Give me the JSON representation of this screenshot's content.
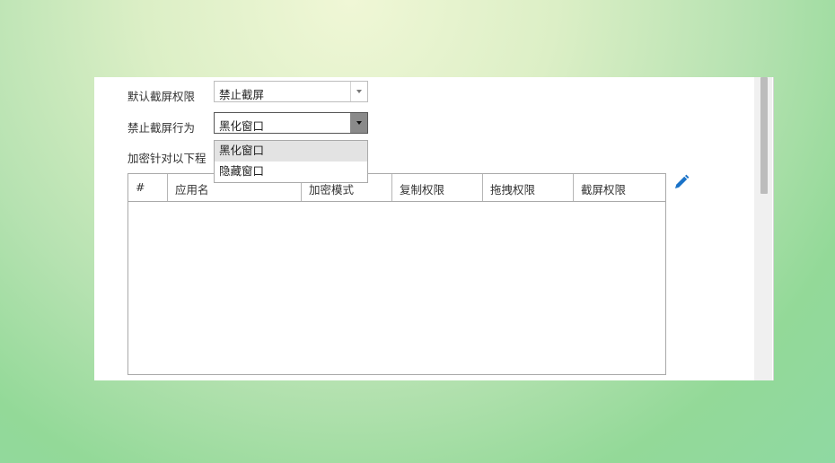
{
  "settings": {
    "default_screenshot_label": "默认截屏权限",
    "default_screenshot_value": "禁止截屏",
    "forbid_behavior_label": "禁止截屏行为",
    "forbid_behavior_value": "黑化窗口",
    "encrypt_label_visible": "加密针对以下程"
  },
  "dropdown": {
    "options": [
      "黑化窗口",
      "隐藏窗口"
    ],
    "selected_index": 0
  },
  "table": {
    "columns": [
      "#",
      "应用名",
      "加密模式",
      "复制权限",
      "拖拽权限",
      "截屏权限"
    ],
    "rows": []
  },
  "icons": {
    "edit": "pencil-icon",
    "accent_color": "#1a73c8"
  }
}
